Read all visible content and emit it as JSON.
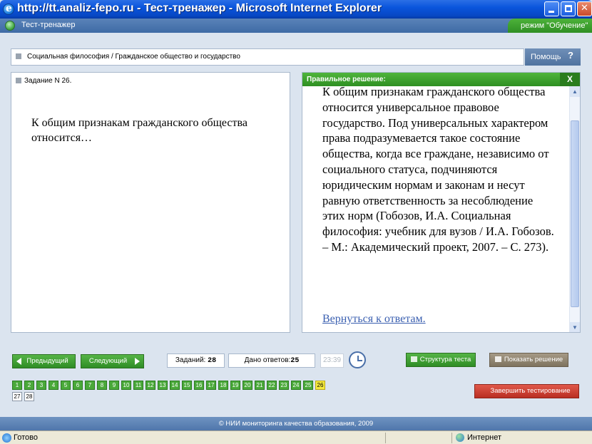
{
  "window": {
    "title": "http://tt.analiz-fepo.ru - Тест-тренажер - Microsoft Internet Explorer",
    "minimize": "_",
    "close": "✕"
  },
  "app": {
    "name": "Тест-тренажер",
    "mode": "режим \"Обучение\""
  },
  "breadcrumb": "Социальная философия / Гражданское общество и государство",
  "help": {
    "label": "Помощь",
    "icon_char": "?"
  },
  "task": {
    "label": "Задание N 26.",
    "question": "К общим признакам гражданского общества относится…"
  },
  "solution": {
    "header": "Правильное решение:",
    "close_char": "X",
    "text": "К общим признакам гражданского общества относится универсальное правовое государство. Под универсальных характером права подразумевается такое состояние общества, когда все граждане, независимо от социального статуса, подчиняются юридическим нормам и законам и несут равную ответственность за несоблюдение этих норм (Гобозов, И.А. Социальная философия: учебник для вузов / И.А. Гобозов. – М.: Академический проект, 2007. – С. 273).",
    "back_link": "Вернуться к ответам."
  },
  "controls": {
    "prev": "Предыдущий",
    "next": "Следующий",
    "tasks_label": "Заданий:",
    "tasks_count": "28",
    "answered_label": "Дано ответов:",
    "answered_count": "25",
    "timer": "23:39",
    "structure": "Структура теста",
    "show_solution": "Показать решение",
    "finish": "Завершить тестирование"
  },
  "task_grid": [
    {
      "n": "1",
      "state": "done"
    },
    {
      "n": "2",
      "state": "done"
    },
    {
      "n": "3",
      "state": "done"
    },
    {
      "n": "4",
      "state": "done"
    },
    {
      "n": "5",
      "state": "done"
    },
    {
      "n": "6",
      "state": "done"
    },
    {
      "n": "7",
      "state": "done"
    },
    {
      "n": "8",
      "state": "done"
    },
    {
      "n": "9",
      "state": "done"
    },
    {
      "n": "10",
      "state": "done"
    },
    {
      "n": "11",
      "state": "done"
    },
    {
      "n": "12",
      "state": "done"
    },
    {
      "n": "13",
      "state": "done"
    },
    {
      "n": "14",
      "state": "done"
    },
    {
      "n": "15",
      "state": "done"
    },
    {
      "n": "16",
      "state": "done"
    },
    {
      "n": "17",
      "state": "done"
    },
    {
      "n": "18",
      "state": "done"
    },
    {
      "n": "19",
      "state": "done"
    },
    {
      "n": "20",
      "state": "done"
    },
    {
      "n": "21",
      "state": "done"
    },
    {
      "n": "22",
      "state": "done"
    },
    {
      "n": "23",
      "state": "done"
    },
    {
      "n": "24",
      "state": "done"
    },
    {
      "n": "25",
      "state": "done"
    },
    {
      "n": "26",
      "state": "active"
    },
    {
      "n": "27",
      "state": "todo"
    },
    {
      "n": "28",
      "state": "todo"
    }
  ],
  "footer": "© НИИ мониторинга качества образования, 2009",
  "statusbar": {
    "status": "Готово",
    "zone": "Интернет"
  },
  "colors": {
    "accent_green": "#3a9d2e",
    "header_blue": "#4f76ab",
    "active_task": "#f5ea3d",
    "finish_red": "#c9392b"
  }
}
